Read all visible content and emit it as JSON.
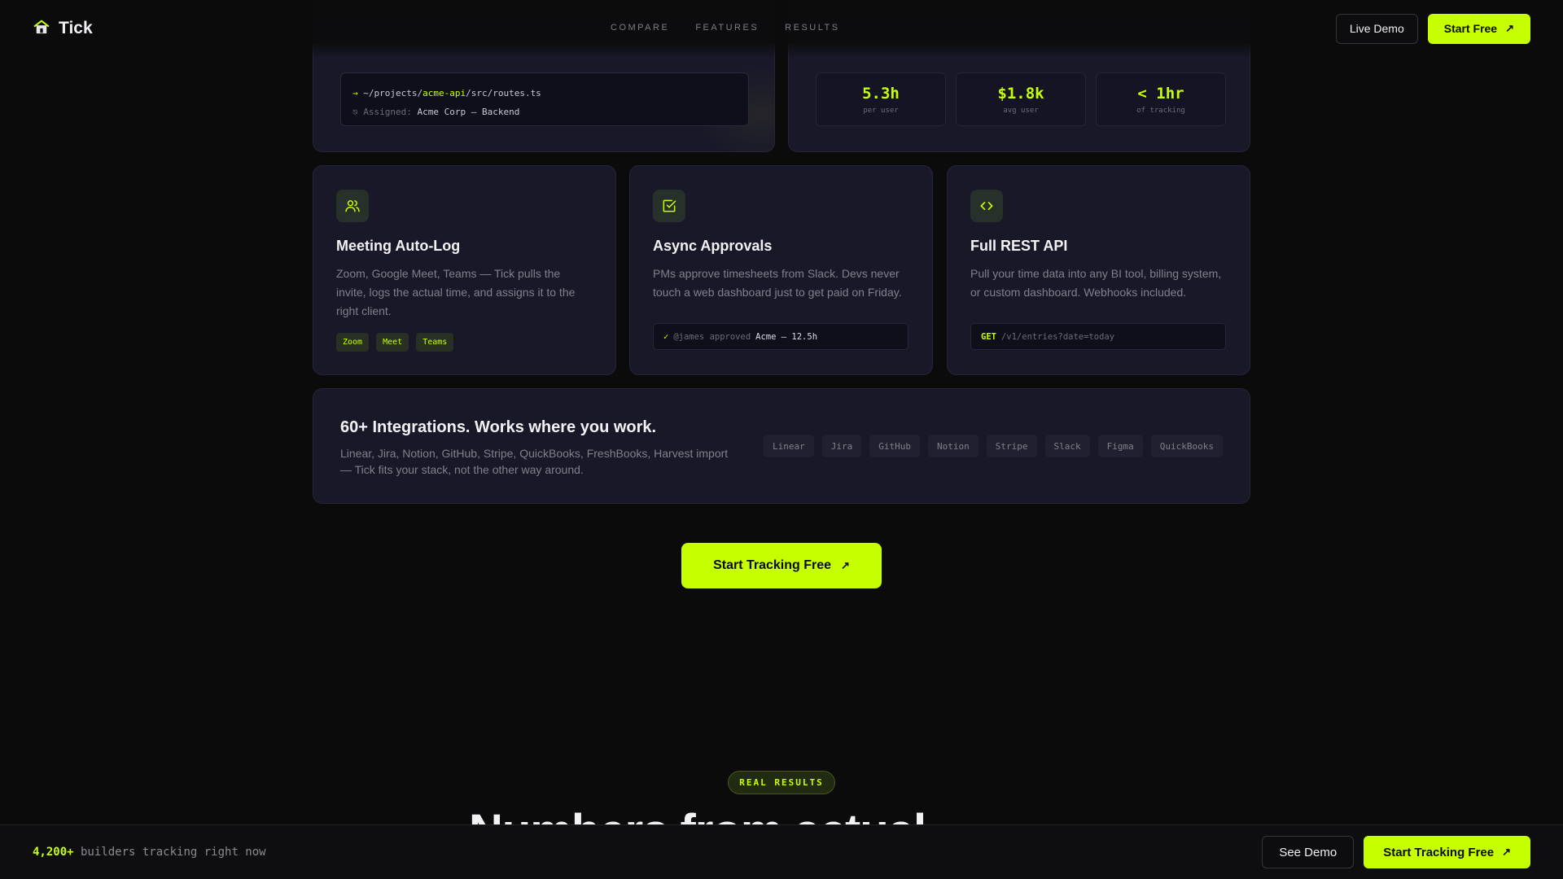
{
  "brand": {
    "name": "Tick"
  },
  "nav": {
    "items": [
      "COMPARE",
      "FEATURES",
      "RESULTS"
    ]
  },
  "header": {
    "live_demo": "Live Demo",
    "start_free": "Start Free"
  },
  "terminal": {
    "arrow": "→",
    "path_prefix": "~/projects/",
    "path_highlight": "acme-api",
    "path_suffix": "/src/routes.ts",
    "assigned_icon": "⎋",
    "assigned_label": "Assigned:",
    "assigned_value": "Acme Corp — Backend"
  },
  "stats": [
    {
      "value": "5.3h",
      "label": "per user"
    },
    {
      "value": "$1.8k",
      "label": "avg user"
    },
    {
      "value": "< 1hr",
      "label": "of tracking"
    }
  ],
  "features": [
    {
      "icon": "users-icon",
      "title": "Meeting Auto-Log",
      "desc": "Zoom, Google Meet, Teams — Tick pulls the invite, logs the actual time, and assigns it to the right client.",
      "chips": [
        "Zoom",
        "Meet",
        "Teams"
      ]
    },
    {
      "icon": "check-square-icon",
      "title": "Async Approvals",
      "desc": "PMs approve timesheets from Slack. Devs never touch a web dashboard just to get paid on Friday.",
      "code": {
        "check": "✓",
        "user": "@james approved",
        "value": "Acme — 12.5h"
      }
    },
    {
      "icon": "code-icon",
      "title": "Full REST API",
      "desc": "Pull your time data into any BI tool, billing system, or custom dashboard. Webhooks included.",
      "code": {
        "method": "GET",
        "path": "/v1/entries?date=today"
      }
    }
  ],
  "integrations": {
    "title": "60+ Integrations. Works where you work.",
    "desc": "Linear, Jira, Notion, GitHub, Stripe, QuickBooks, FreshBooks, Harvest import — Tick fits your stack, not the other way around.",
    "tags": [
      "Linear",
      "Jira",
      "GitHub",
      "Notion",
      "Stripe",
      "Slack",
      "Figma",
      "QuickBooks"
    ]
  },
  "cta": {
    "label": "Start Tracking Free"
  },
  "results": {
    "badge": "REAL RESULTS",
    "heading_partial": "Numbers from actual"
  },
  "bottombar": {
    "count": "4,200+",
    "text": " builders tracking right now",
    "see_demo": "See Demo",
    "start": "Start Tracking Free"
  },
  "colors": {
    "accent": "#c6ff00",
    "card": "#181829",
    "bg": "#0b0b0c"
  }
}
